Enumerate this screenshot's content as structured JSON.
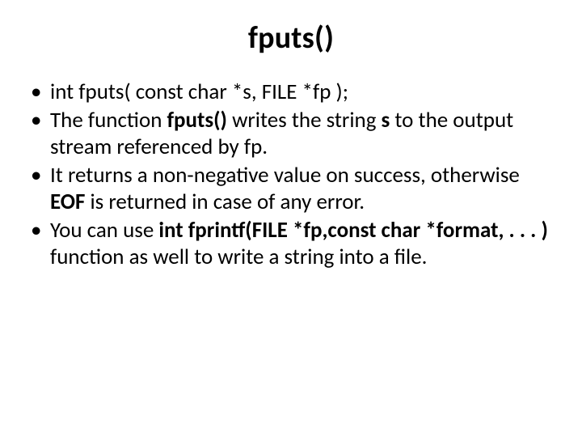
{
  "title": "fputs()",
  "bullets": {
    "b0": "int fputs( const char *s, FILE *fp );",
    "b1_a": "The function ",
    "b1_b": "fputs()",
    "b1_c": " writes the string ",
    "b1_d": "s",
    "b1_e": " to the output stream referenced by fp.",
    "b2_a": "It returns a non-negative value on success, otherwise ",
    "b2_b": "EOF",
    "b2_c": " is returned in case of any error.",
    "b3_a": "You can use ",
    "b3_b": "int fprintf(FILE *fp,const char *format, . . . )",
    "b3_c": " function as well to write a string into a file."
  }
}
